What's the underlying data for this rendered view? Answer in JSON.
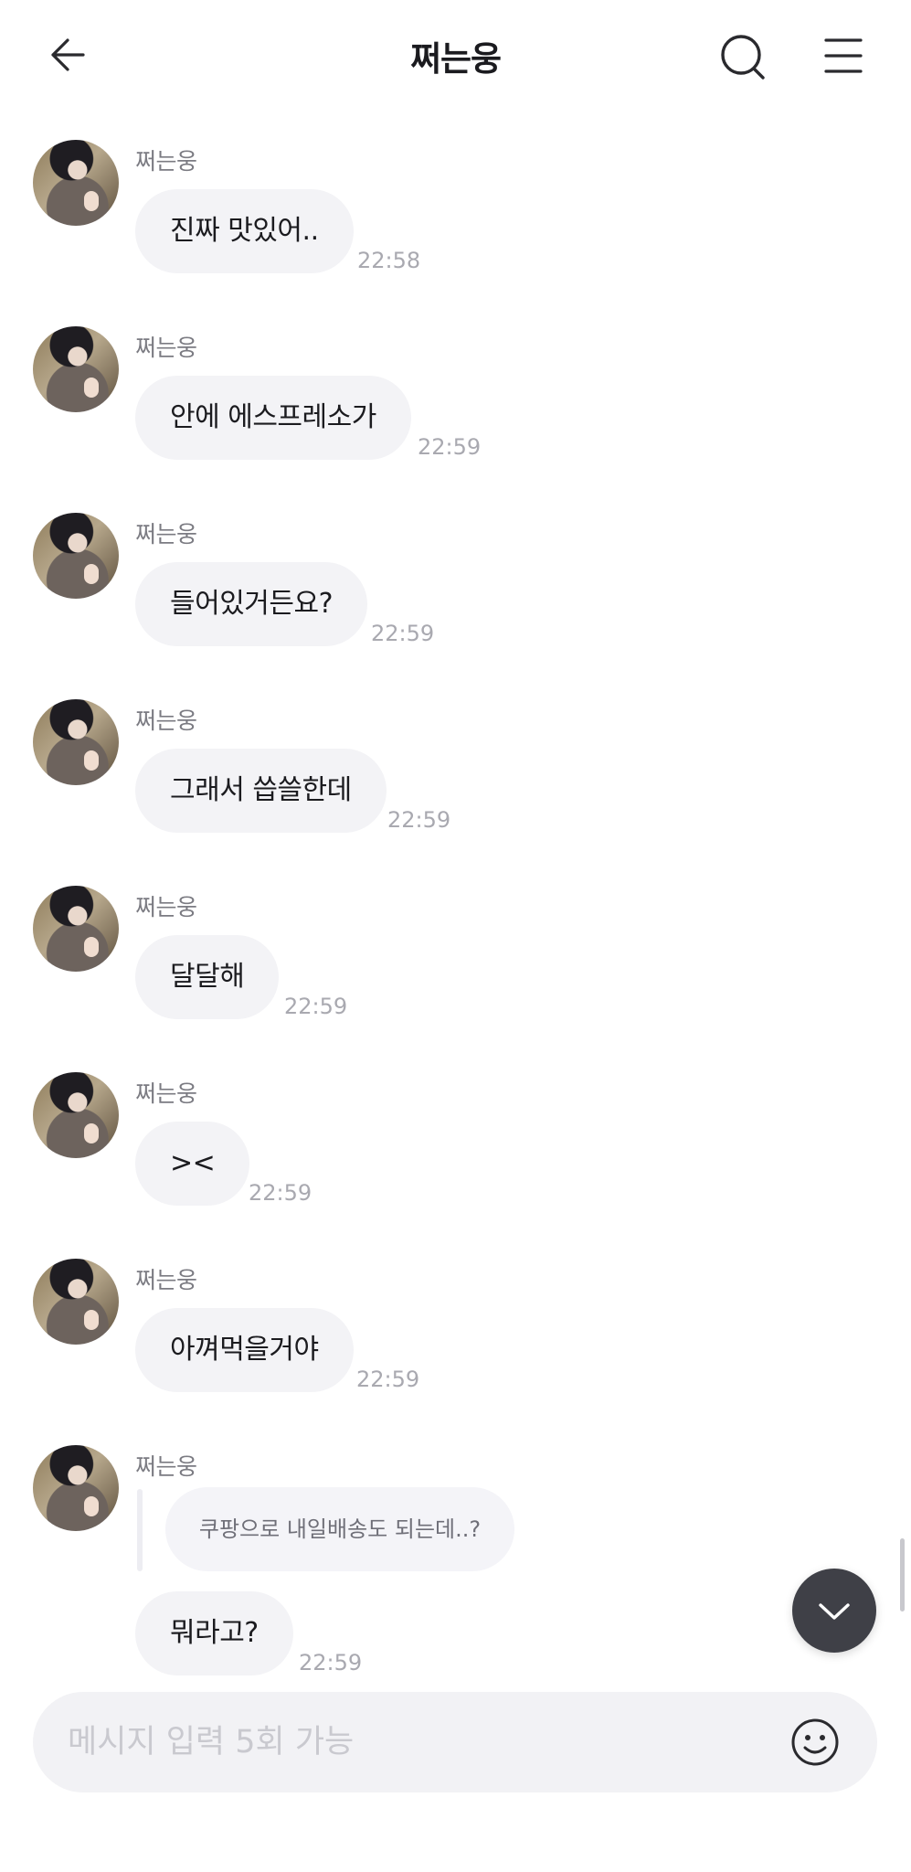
{
  "header": {
    "title": "쩌는웅",
    "back_icon": "arrow-left-icon",
    "search_icon": "search-icon",
    "menu_icon": "hamburger-menu-icon"
  },
  "messages": [
    {
      "sender": "쩌는웅",
      "text": "진짜 맛있어..",
      "time": "22:58"
    },
    {
      "sender": "쩌는웅",
      "text": "안에 에스프레소가",
      "time": "22:59"
    },
    {
      "sender": "쩌는웅",
      "text": "들어있거든요?",
      "time": "22:59"
    },
    {
      "sender": "쩌는웅",
      "text": "그래서 씁쓸한데",
      "time": "22:59"
    },
    {
      "sender": "쩌는웅",
      "text": "달달해",
      "time": "22:59"
    },
    {
      "sender": "쩌는웅",
      "text": "><",
      "time": "22:59"
    },
    {
      "sender": "쩌는웅",
      "text": "아껴먹을거야",
      "time": "22:59"
    },
    {
      "sender": "쩌는웅",
      "reply_to": "쿠팡으로 내일배송도 되는데..?",
      "text": "뭐라고?",
      "time": "22:59"
    }
  ],
  "input": {
    "placeholder": "메시지 입력 5회 가능",
    "value": "",
    "emoji_icon": "smiley-face-icon"
  },
  "scroll_down_icon": "chevron-down-icon",
  "colors": {
    "bubble_bg": "#f3f3f6",
    "text": "#1b1b1f",
    "sender_text": "#7b7b82",
    "time_text": "#a9a9b0",
    "scroll_button_bg": "#3f4047"
  }
}
